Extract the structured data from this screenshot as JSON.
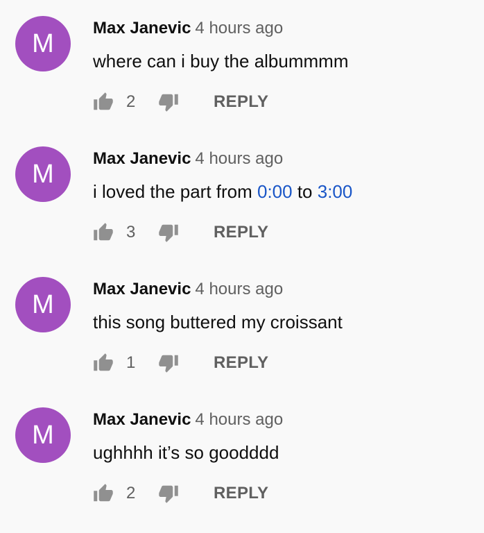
{
  "comments": [
    {
      "avatar_letter": "M",
      "author": "Max Janevic",
      "time": "4 hours ago",
      "text": "where can i buy the albummmm",
      "likes": "2",
      "reply_label": "REPLY"
    },
    {
      "avatar_letter": "M",
      "author": "Max Janevic",
      "time": "4 hours ago",
      "text_before": "i loved the part from ",
      "timestamp_1": "0:00",
      "text_middle": " to ",
      "timestamp_2": "3:00",
      "likes": "3",
      "reply_label": "REPLY"
    },
    {
      "avatar_letter": "M",
      "author": "Max Janevic",
      "time": "4 hours ago",
      "text": "this song buttered my croissant",
      "likes": "1",
      "reply_label": "REPLY"
    },
    {
      "avatar_letter": "M",
      "author": "Max Janevic",
      "time": "4 hours ago",
      "text": "ughhhh it’s so goodddd",
      "likes": "2",
      "reply_label": "REPLY"
    }
  ],
  "colors": {
    "avatar": "#a24fbf",
    "link": "#1a56c7",
    "secondary_text": "#606060",
    "background": "#f9f9f9"
  },
  "icons": {
    "like": "thumbs-up-icon",
    "dislike": "thumbs-down-icon"
  }
}
